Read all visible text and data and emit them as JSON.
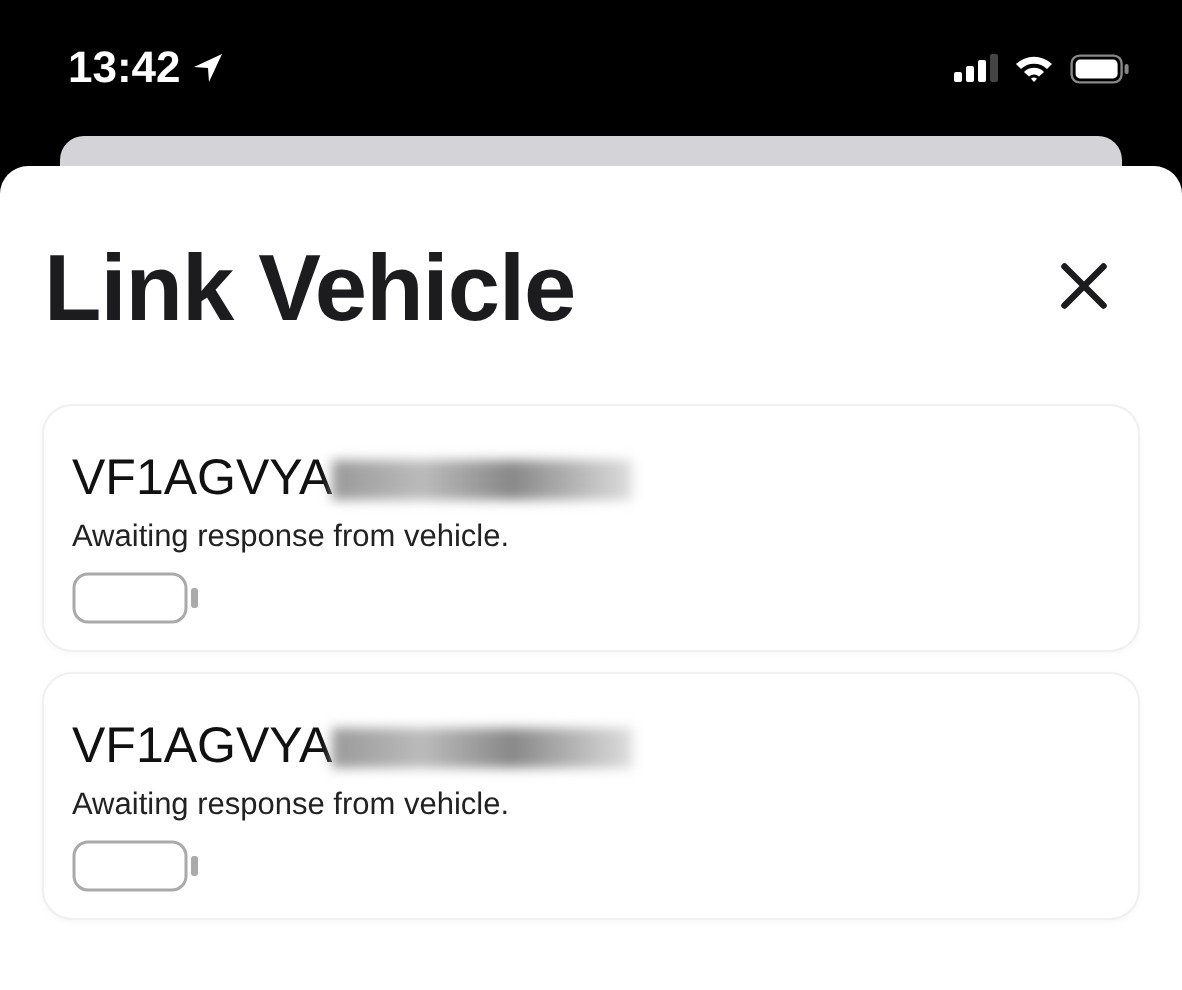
{
  "status_bar": {
    "time": "13:42"
  },
  "sheet": {
    "title": "Link Vehicle"
  },
  "vehicles": [
    {
      "vin": "VF1AGVYA",
      "status": "Awaiting response from vehicle."
    },
    {
      "vin": "VF1AGVYA",
      "status": "Awaiting response from vehicle."
    }
  ]
}
